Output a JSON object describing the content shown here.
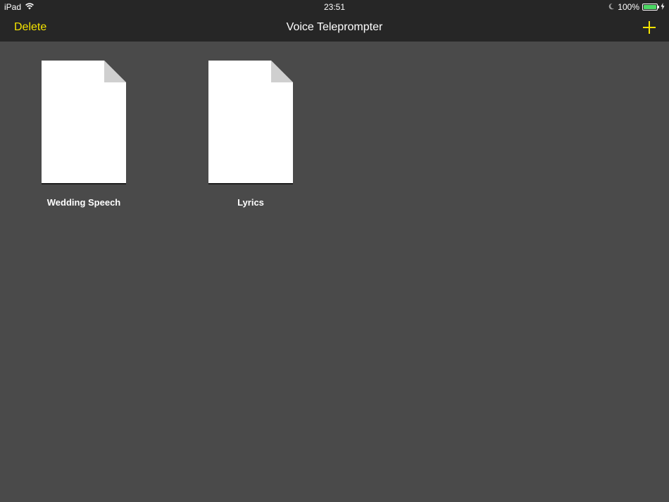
{
  "status_bar": {
    "device": "iPad",
    "time": "23:51",
    "battery_percent": "100%",
    "battery_level": 1.0,
    "battery_color": "#4cd964",
    "icons": [
      "wifi-icon",
      "moon-icon",
      "battery-icon",
      "charging-icon"
    ]
  },
  "nav": {
    "delete_label": "Delete",
    "title": "Voice Teleprompter",
    "add_icon": "plus-icon",
    "accent_color": "#f5e400"
  },
  "documents": [
    {
      "name": "Wedding Speech",
      "icon": "document-icon"
    },
    {
      "name": "Lyrics",
      "icon": "document-icon"
    }
  ]
}
